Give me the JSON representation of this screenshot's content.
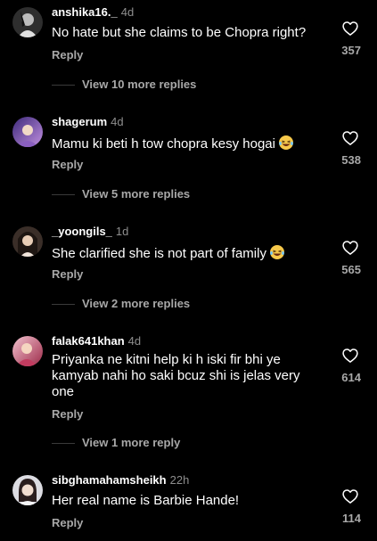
{
  "comments": [
    {
      "username": "anshika16._",
      "age": "4d",
      "text": "No hate but she claims to be Chopra right?",
      "has_emoji": false,
      "reply_label": "Reply",
      "likes": "357",
      "view_more": "View 10 more replies",
      "avatar_colors": [
        "#3b3b3b",
        "#d9d9d9"
      ]
    },
    {
      "username": "shagerum",
      "age": "4d",
      "text": "Mamu ki beti h tow chopra kesy hogai",
      "has_emoji": true,
      "emoji": "laughing-emoji",
      "reply_label": "Reply",
      "likes": "538",
      "view_more": "View 5 more replies",
      "avatar_colors": [
        "#6a4ea8",
        "#c7a0e8"
      ]
    },
    {
      "username": "_yoongils_",
      "age": "1d",
      "text": "She clarified she is not part of family",
      "has_emoji": true,
      "emoji": "laughing-emoji",
      "reply_label": "Reply",
      "likes": "565",
      "view_more": "View 2 more replies",
      "avatar_colors": [
        "#4a3a30",
        "#e6d2c0"
      ]
    },
    {
      "username": "falak641khan",
      "age": "4d",
      "text": "Priyanka ne kitni help ki h iski fir bhi ye kamyab nahi ho saki bcuz shi is jelas very one",
      "has_emoji": false,
      "reply_label": "Reply",
      "likes": "614",
      "view_more": "View 1 more reply",
      "avatar_colors": [
        "#b03a5a",
        "#f0b8c8"
      ]
    },
    {
      "username": "sibghamahamsheikh",
      "age": "22h",
      "text": "Her real name is Barbie Hande!",
      "has_emoji": false,
      "reply_label": "Reply",
      "likes": "114",
      "avatar_colors": [
        "#d8d8de",
        "#3a2a2a"
      ]
    }
  ],
  "icons": {
    "like": "heart-outline-icon"
  },
  "colors": {
    "background": "#000000",
    "primary_text": "#ffffff",
    "secondary_text": "#a8a8a8"
  }
}
